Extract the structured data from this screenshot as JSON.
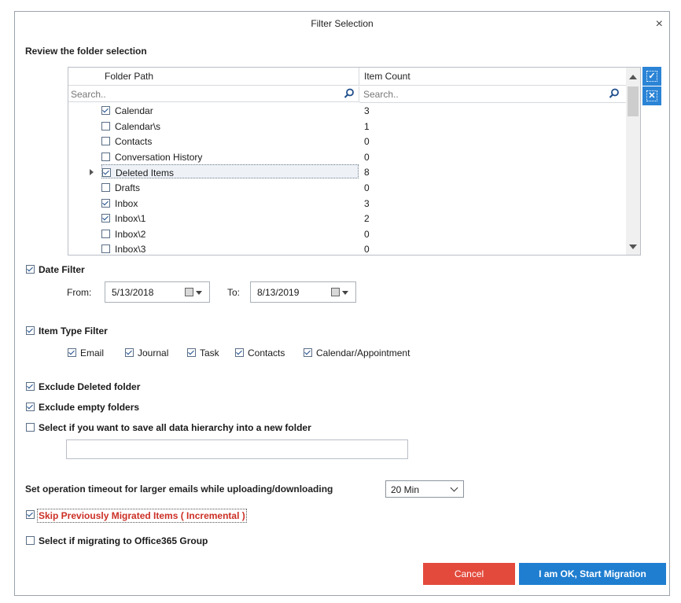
{
  "dialog": {
    "title": "Filter Selection",
    "close_label": "×"
  },
  "folders": {
    "section_title": "Review the folder selection",
    "headers": {
      "path": "Folder Path",
      "count": "Item Count"
    },
    "search_placeholder": "Search..",
    "rows": [
      {
        "name": "Calendar",
        "count": "3",
        "checked": true
      },
      {
        "name": "Calendar\\s",
        "count": "1",
        "checked": false
      },
      {
        "name": "Contacts",
        "count": "0",
        "checked": false
      },
      {
        "name": "Conversation History",
        "count": "0",
        "checked": false
      },
      {
        "name": "Deleted Items",
        "count": "8",
        "checked": true,
        "selected": true,
        "expandable": true
      },
      {
        "name": "Drafts",
        "count": "0",
        "checked": false
      },
      {
        "name": "Inbox",
        "count": "3",
        "checked": true
      },
      {
        "name": "Inbox\\1",
        "count": "2",
        "checked": true
      },
      {
        "name": "Inbox\\2",
        "count": "0",
        "checked": false
      },
      {
        "name": "Inbox\\3",
        "count": "0",
        "checked": false
      }
    ]
  },
  "date_filter": {
    "label": "Date Filter",
    "checked": true,
    "from_label": "From:",
    "from_value": "5/13/2018",
    "to_label": "To:",
    "to_value": "8/13/2019"
  },
  "item_type_filter": {
    "label": "Item Type Filter",
    "checked": true,
    "types": [
      {
        "label": "Email",
        "checked": true
      },
      {
        "label": "Journal",
        "checked": true
      },
      {
        "label": "Task",
        "checked": true
      },
      {
        "label": "Contacts",
        "checked": true
      },
      {
        "label": "Calendar/Appointment",
        "checked": true
      }
    ]
  },
  "options": {
    "exclude_deleted": {
      "label": "Exclude Deleted folder",
      "checked": true
    },
    "exclude_empty": {
      "label": "Exclude empty folders",
      "checked": true
    },
    "save_hierarchy": {
      "label": "Select if you want to save all data hierarchy into a new folder",
      "checked": false,
      "folder_value": ""
    },
    "timeout_label": "Set operation timeout for larger emails while uploading/downloading",
    "timeout_value": "20 Min",
    "skip_migrated": {
      "label": "Skip Previously Migrated Items ( Incremental )",
      "checked": true
    },
    "office365_group": {
      "label": "Select if migrating to Office365 Group",
      "checked": false
    }
  },
  "buttons": {
    "cancel": "Cancel",
    "ok": "I am OK, Start Migration"
  },
  "colors": {
    "accent": "#1f7ed0",
    "cancel": "#e34a3c",
    "incremental_text": "#cc2f25"
  }
}
